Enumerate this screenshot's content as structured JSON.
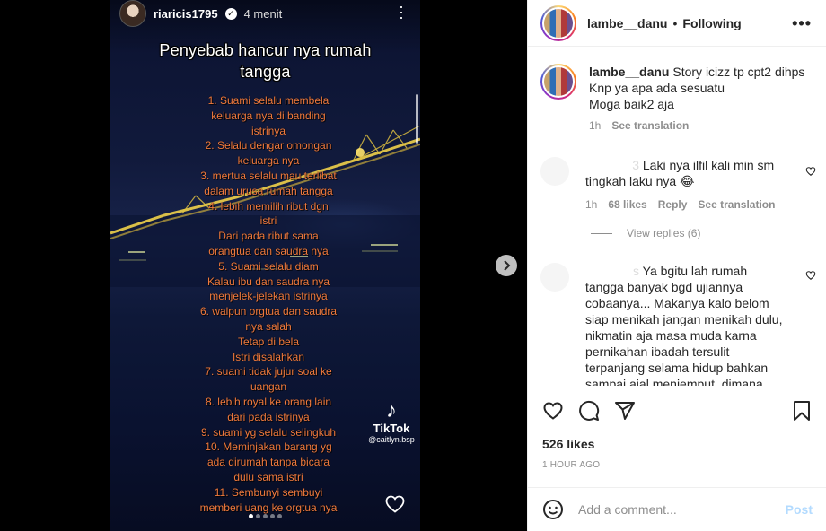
{
  "story": {
    "username": "riaricis1795",
    "time": "4 menit",
    "title_lines": [
      "Penyebab hancur nya rumah",
      "tangga"
    ],
    "lines": [
      "1. Suami selalu membela",
      "keluarga nya di banding",
      "istrinya",
      "2. Selalu dengar omongan",
      "keluarga nya",
      "3. mertua selalu mau terlibat",
      "dalam urusa rumah tangga",
      "4. lebih memilih ribut dgn",
      "istri",
      "Dari pada ribut sama",
      "orangtua dan saudra nya",
      "5. Suami selalu diam",
      "Kalau ibu dan saudra nya",
      "menjelek-jelekan istrinya",
      "6. walpun orgtua dan saudra",
      "nya salah",
      "Tetap di bela",
      "Istri disalahkan",
      "7. suami tidak jujur soal ke",
      "uangan",
      "8. lebih royal ke orang lain",
      "dari pada istrinya",
      "9. suami yg selalu selingkuh",
      "10. Meminjakan barang yg",
      "ada dirumah tanpa bicara",
      "dulu sama istri",
      "11. Sembunyi sembuyi",
      "memberi uang ke orgtua nya"
    ],
    "tiktok_label": "TikTok",
    "tiktok_handle": "@caitlyn.bsp",
    "dots_count": 5,
    "active_dot": 0
  },
  "header": {
    "username": "lambe__danu",
    "separator": "•",
    "follow_status": "Following",
    "more_icon": "ellipsis-icon"
  },
  "caption": {
    "username": "lambe__danu",
    "text_line1": "Story icizz tp cpt2 dihps",
    "text_line2": "Knp ya apa ada sesuatu",
    "text_line3": "Moga baik2 aja",
    "time": "1h",
    "see_translation": "See translation"
  },
  "comments": [
    {
      "username_fragment": "3",
      "line1": "Laki nya ilfil kali min sm",
      "line2": "tingkah laku nya 😂",
      "time": "1h",
      "likes": "68 likes",
      "reply": "Reply",
      "see_translation": "See translation"
    },
    {
      "username_fragment": "s",
      "lines": [
        "Ya bgitu lah rumah",
        "tangga banyak bgd ujiannya",
        "cobaanya... Makanya kalo belom",
        "siap menikah jangan menikah dulu,",
        "nikmatin aja masa muda karna",
        "pernikahan ibadah tersulit",
        "terpanjang selama hidup bahkan",
        "sampai ajal menjemput, dimana"
      ]
    }
  ],
  "view_replies": "View replies (6)",
  "actions": {
    "like_icon": "heart-icon",
    "comment_icon": "comment-icon",
    "share_icon": "share-icon",
    "save_icon": "bookmark-icon"
  },
  "likes": "526 likes",
  "posted_ago": "1 HOUR AGO",
  "add_comment": {
    "placeholder": "Add a comment...",
    "post_label": "Post",
    "emoji_icon": "emoji-icon"
  },
  "colors": {
    "story_text": "#f07a3e",
    "post_button_disabled": "#b3dbff",
    "secondary_text": "#8e8e8e"
  }
}
